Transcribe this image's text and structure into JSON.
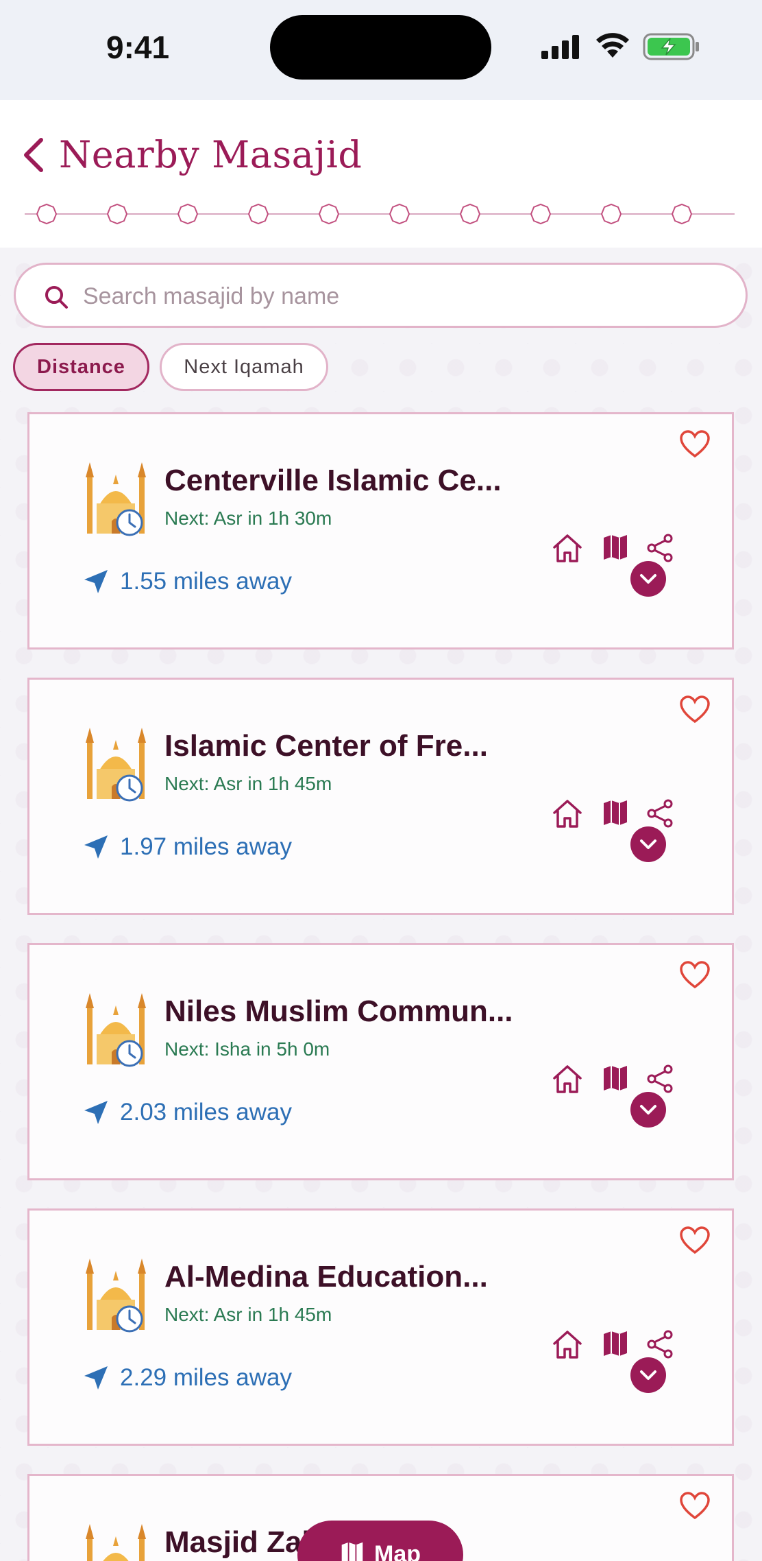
{
  "status_bar": {
    "time": "9:41"
  },
  "header": {
    "title": "Nearby Masajid"
  },
  "search": {
    "placeholder": "Search masajid by name"
  },
  "sort_chips": [
    {
      "label": "Distance",
      "active": true
    },
    {
      "label": "Next Iqamah",
      "active": false
    }
  ],
  "masajid": [
    {
      "name": "Centerville Islamic Ce...",
      "next": "Next: Asr in 1h 30m",
      "distance": "1.55 miles away"
    },
    {
      "name": "Islamic Center of Fre...",
      "next": "Next: Asr in 1h 45m",
      "distance": "1.97 miles away"
    },
    {
      "name": "Niles Muslim Commun...",
      "next": "Next: Isha in 5h 0m",
      "distance": "2.03 miles away"
    },
    {
      "name": "Al-Medina Education...",
      "next": "Next: Asr in 1h 45m",
      "distance": "2.29 miles away"
    },
    {
      "name": "Masjid Zak...",
      "next": "",
      "distance": ""
    }
  ],
  "map_button": {
    "label": "Map"
  },
  "colors": {
    "brand": "#9b1b57",
    "next_prayer": "#2a7a52",
    "distance": "#2d6fb5",
    "favorite": "#e0463a"
  },
  "icons": [
    "back-icon",
    "search-icon",
    "mosque-icon",
    "location-arrow-icon",
    "heart-icon",
    "home-icon",
    "map-icon",
    "share-icon",
    "chevron-down-icon"
  ]
}
